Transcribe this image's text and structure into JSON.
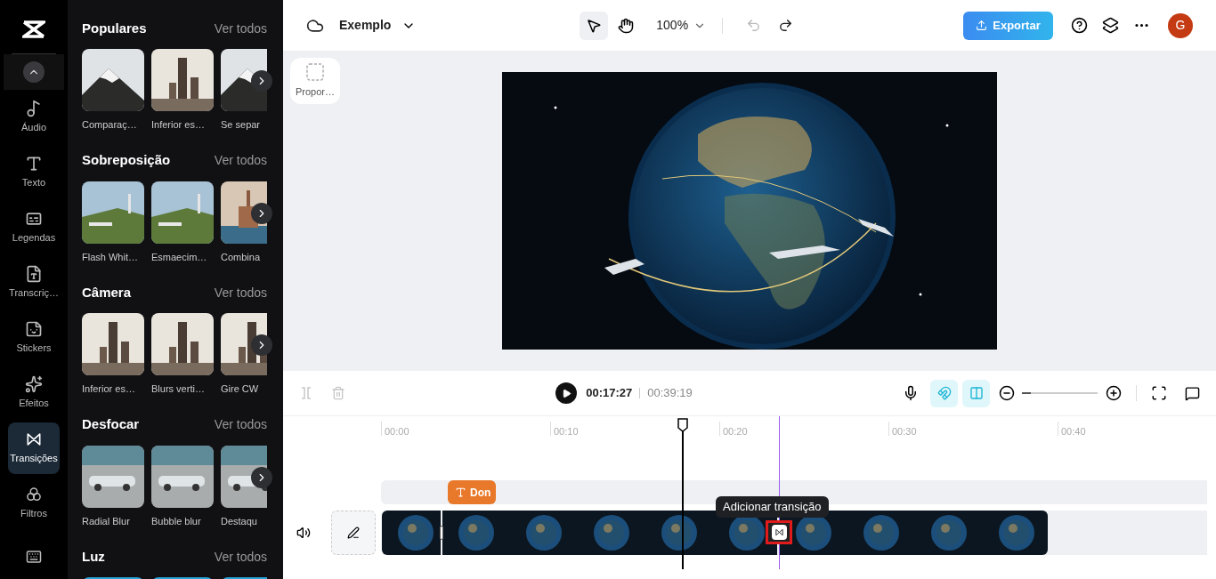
{
  "rail": {
    "items": [
      {
        "label": "Áudio",
        "selected": false
      },
      {
        "label": "Texto",
        "selected": false
      },
      {
        "label": "Legendas",
        "selected": false
      },
      {
        "label": "Transcriç…",
        "selected": false
      },
      {
        "label": "Stickers",
        "selected": false
      },
      {
        "label": "Efeitos",
        "selected": false
      },
      {
        "label": "Transições",
        "selected": true
      },
      {
        "label": "Filtros",
        "selected": false
      }
    ]
  },
  "panel": {
    "sections": [
      {
        "title": "Populares",
        "see_all": "Ver todos",
        "items": [
          {
            "label": "Comparaç…"
          },
          {
            "label": "Inferior es…"
          },
          {
            "label": "Se separ"
          }
        ]
      },
      {
        "title": "Sobreposição",
        "see_all": "Ver todos",
        "items": [
          {
            "label": "Flash Whit…"
          },
          {
            "label": "Esmaecim…"
          },
          {
            "label": "Combina"
          }
        ]
      },
      {
        "title": "Câmera",
        "see_all": "Ver todos",
        "items": [
          {
            "label": "Inferior es…"
          },
          {
            "label": "Blurs verti…"
          },
          {
            "label": "Gire CW"
          }
        ]
      },
      {
        "title": "Desfocar",
        "see_all": "Ver todos",
        "items": [
          {
            "label": "Radial Blur"
          },
          {
            "label": "Bubble blur"
          },
          {
            "label": "Destaqu"
          }
        ]
      },
      {
        "title": "Luz",
        "see_all": "Ver todos"
      }
    ]
  },
  "topbar": {
    "project": "Exemplo",
    "zoom": "100%",
    "export": "Exportar",
    "avatar": "G",
    "select_tool_selected": true,
    "undo_disabled": true,
    "redo_disabled": false
  },
  "canvas": {
    "aspect_button": "Propor…"
  },
  "timeline_toolbar": {
    "split_disabled": true,
    "delete_disabled": true,
    "current_time": "00:17:27",
    "total_time": "00:39:19",
    "snap_on": true,
    "split_scene_on": true,
    "zoom": {
      "level": 0.12
    }
  },
  "timeline": {
    "ruler": [
      "00:00",
      "00:10",
      "00:20",
      "00:30",
      "00:40"
    ],
    "text_clip": "Don",
    "tooltip": "Adicionar transição"
  }
}
